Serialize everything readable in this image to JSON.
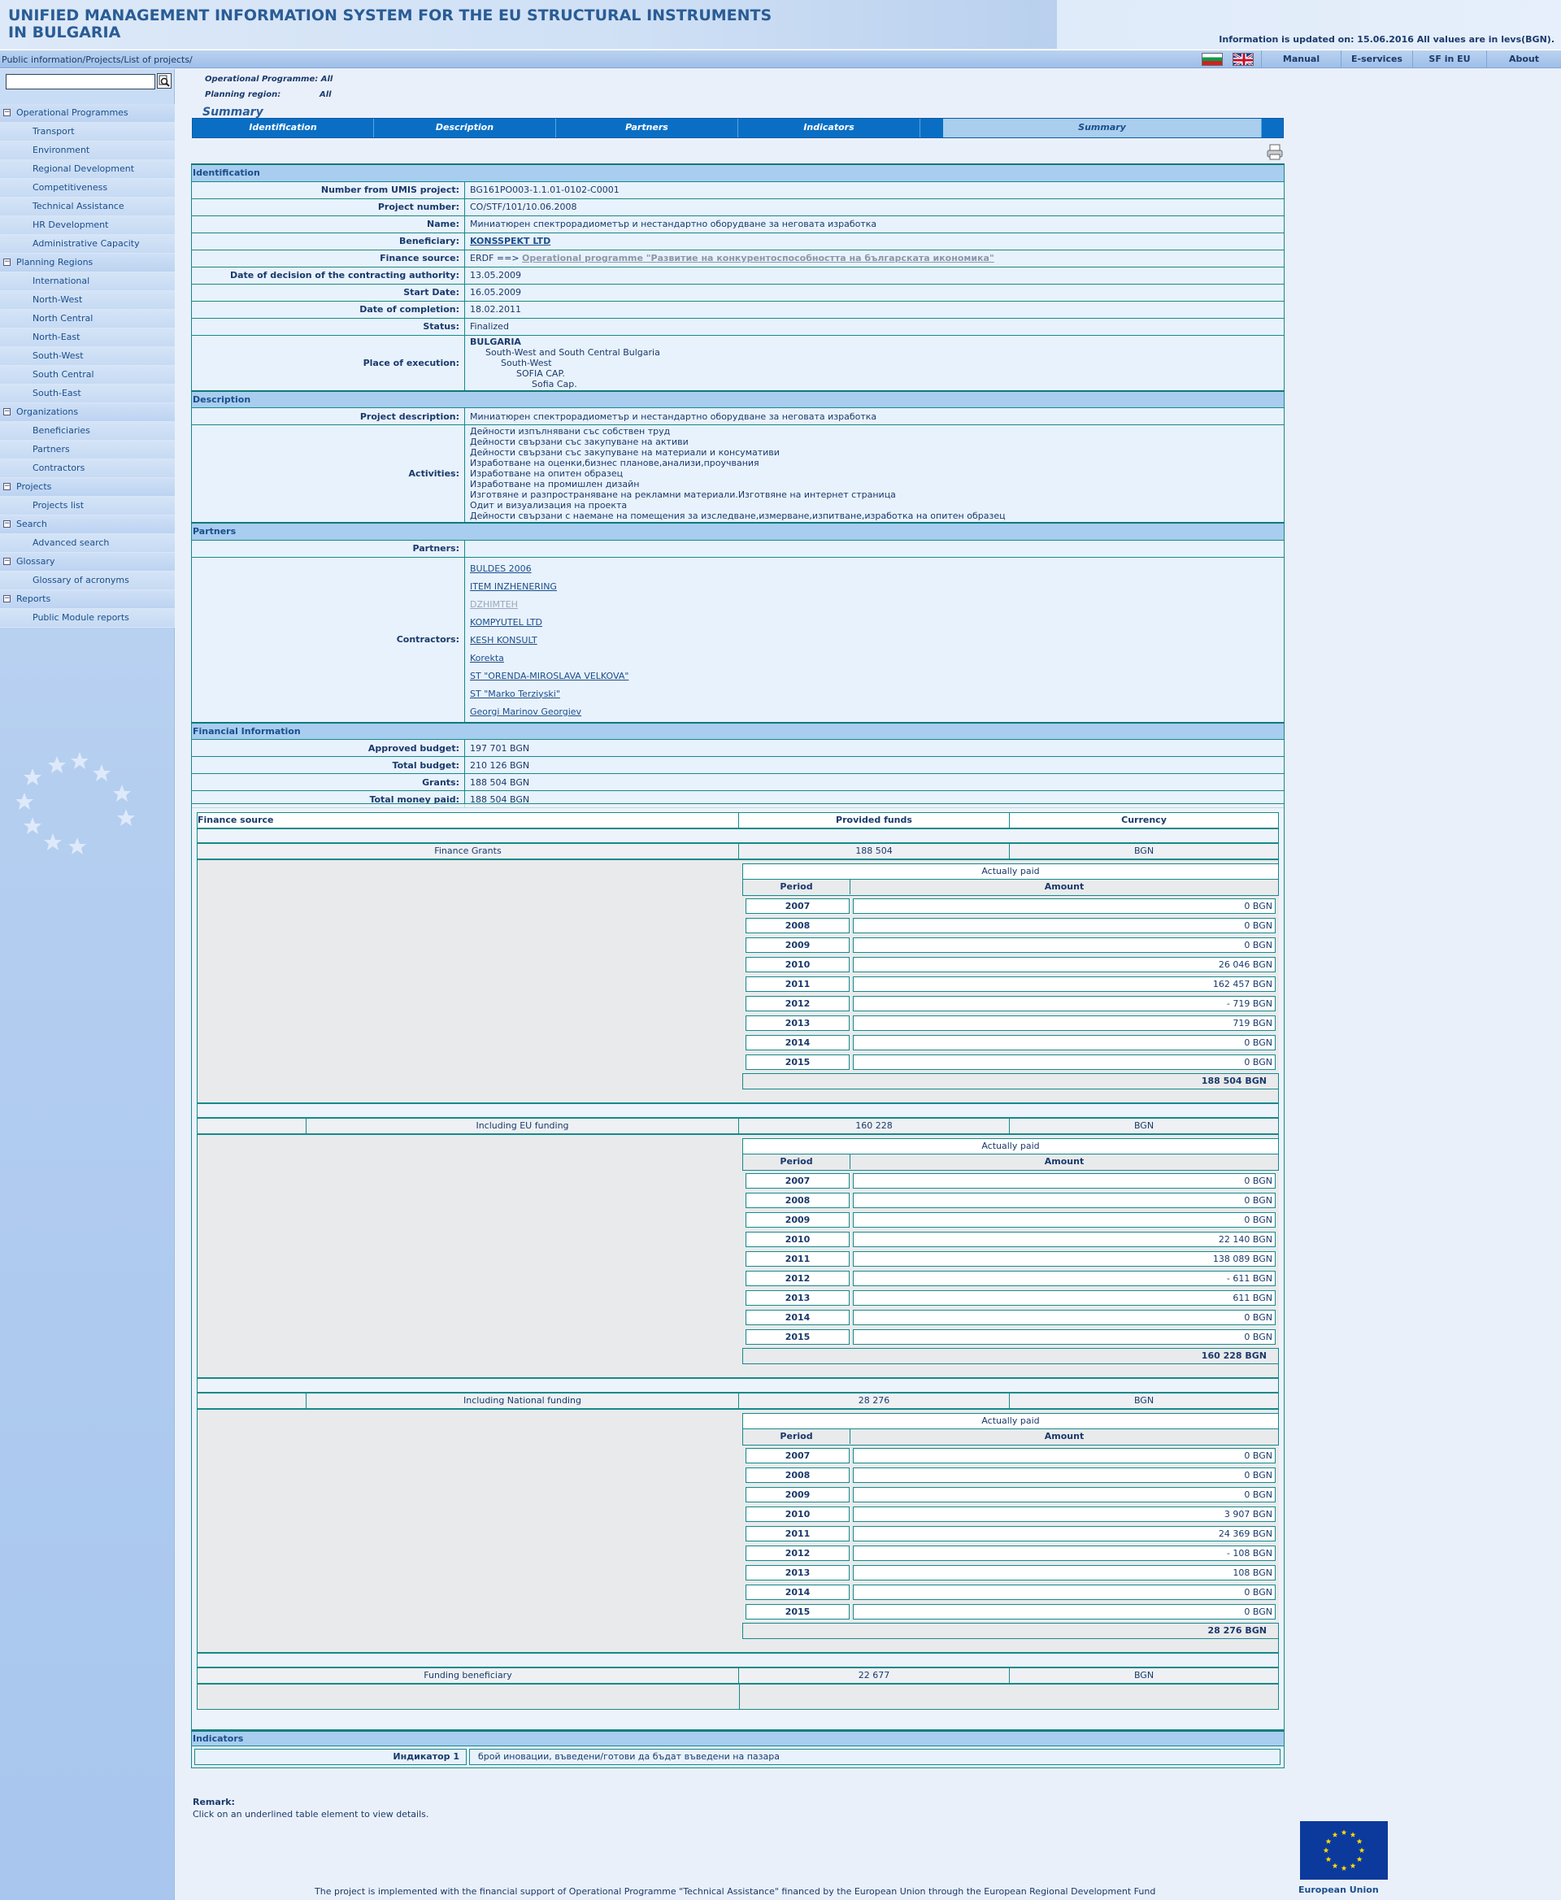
{
  "header": {
    "title_line1": "UNIFIED MANAGEMENT INFORMATION SYSTEM FOR THE EU STRUCTURAL INSTRUMENTS",
    "title_line2": "IN BULGARIA",
    "update_info": "Information is updated on: 15.06.2016 All values are in levs(BGN)."
  },
  "topbar": {
    "breadcrumb": "Public information/Projects/List of projects/",
    "nav": [
      "Manual",
      "E-services",
      "SF in EU",
      "About"
    ]
  },
  "sidebar": {
    "search_value": "",
    "groups": [
      {
        "label": "Operational Programmes",
        "items": [
          "Transport",
          "Environment",
          "Regional Development",
          "Competitiveness",
          "Technical Assistance",
          "HR Development",
          "Administrative Capacity"
        ]
      },
      {
        "label": "Planning Regions",
        "items": [
          "International",
          "North-West",
          "North Central",
          "North-East",
          "South-West",
          "South Central",
          "South-East"
        ]
      },
      {
        "label": "Organizations",
        "items": [
          "Beneficiaries",
          "Partners",
          "Contractors"
        ]
      },
      {
        "label": "Projects",
        "items": [
          "Projects list"
        ]
      },
      {
        "label": "Search",
        "items": [
          "Advanced search"
        ]
      },
      {
        "label": "Glossary",
        "items": [
          "Glossary of acronyms"
        ]
      },
      {
        "label": "Reports",
        "items": [
          "Public Module reports"
        ]
      }
    ]
  },
  "filters": {
    "operational_programme": "Operational Programme: All",
    "planning_region_label": "Planning region:",
    "planning_region_value": "All"
  },
  "page_title": "Summary",
  "tabs": [
    "Identification",
    "Description",
    "Partners",
    "Indicators",
    "Summary"
  ],
  "identification": {
    "heading": "Identification",
    "rows": [
      {
        "label": "Number from UMIS project:",
        "value": "BG161PO003-1.1.01-0102-C0001"
      },
      {
        "label": "Project number:",
        "value": "CO/STF/101/10.06.2008"
      },
      {
        "label": "Name:",
        "value": "Миниатюрен спектрорадиометър и нестандартно оборудване за неговата изработка"
      },
      {
        "label": "Beneficiary:",
        "value": "KONSSPEKT LTD"
      },
      {
        "label": "Finance source:",
        "value_prefix": "ERDF ==>",
        "value": "Operational programme \"Развитие на конкурентоспособността на българската икономика\""
      },
      {
        "label": "Date of decision of the contracting authority:",
        "value": "13.05.2009"
      },
      {
        "label": "Start Date:",
        "value": "16.05.2009"
      },
      {
        "label": "Date of completion:",
        "value": "18.02.2011"
      },
      {
        "label": "Status:",
        "value": "Finalized"
      }
    ],
    "place_label": "Place of execution:",
    "place": [
      "BULGARIA",
      "South-West and South Central Bulgaria",
      "South-West",
      "SOFIA CAP.",
      "Sofia Cap."
    ]
  },
  "description": {
    "heading": "Description",
    "project_description_label": "Project description:",
    "project_description": "Миниатюрен спектрорадиометър и нестандартно оборудване за неговата изработка",
    "activities_label": "Activities:",
    "activities": [
      "Дейности изпълнявани със собствен труд",
      "Дейности свързани със закупуване на активи",
      "Дейности свързани със закупуване на материали и консумативи",
      "Изработване на оценки,бизнес планове,анализи,проучвания",
      "Изработване на опитен образец",
      "Изработване на промишлен дизайн",
      "Изготвяне и разпространяване на рекламни материали.Изготвяне на интернет страница",
      "Одит и визуализация на проекта",
      "Дейности свързани с наемане на помещения за изследване,измерване,изпитване,изработка на опитен образец"
    ]
  },
  "partners": {
    "heading": "Partners",
    "partners_label": "Partners:",
    "contractors_label": "Contractors:",
    "contractors": [
      "BULDES 2006",
      "ITEM INZHENERING",
      "DZHIMTEH",
      "KOMPYUTEL LTD",
      "KESH KONSULT",
      "Korekta",
      "ST \"ORENDA-MIROSLAVA VELKOVA\"",
      "ST \"Marko Terziyski\"",
      "Georgi Marinov Georgiev"
    ]
  },
  "financial": {
    "heading": "Financial Information",
    "rows": [
      {
        "label": "Approved budget:",
        "value": "197 701 BGN"
      },
      {
        "label": "Total budget:",
        "value": "210 126 BGN"
      },
      {
        "label": "Grants:",
        "value": "188 504 BGN"
      },
      {
        "label": "Total money paid:",
        "value": "188 504 BGN"
      }
    ],
    "columns": [
      "Finance source",
      "Provided funds",
      "Currency"
    ],
    "actually_paid_label": "Actually paid",
    "period_label": "Period",
    "amount_label": "Amount",
    "blocks": [
      {
        "name": "Finance Grants",
        "funds": "188 504",
        "currency": "BGN",
        "paid": [
          [
            "2007",
            "0 BGN"
          ],
          [
            "2008",
            "0 BGN"
          ],
          [
            "2009",
            "0 BGN"
          ],
          [
            "2010",
            "26 046 BGN"
          ],
          [
            "2011",
            "162 457 BGN"
          ],
          [
            "2012",
            "- 719 BGN"
          ],
          [
            "2013",
            "719 BGN"
          ],
          [
            "2014",
            "0 BGN"
          ],
          [
            "2015",
            "0 BGN"
          ]
        ],
        "total": "188 504 BGN"
      },
      {
        "name": "Including EU funding",
        "funds": "160 228",
        "currency": "BGN",
        "paid": [
          [
            "2007",
            "0 BGN"
          ],
          [
            "2008",
            "0 BGN"
          ],
          [
            "2009",
            "0 BGN"
          ],
          [
            "2010",
            "22 140 BGN"
          ],
          [
            "2011",
            "138 089 BGN"
          ],
          [
            "2012",
            "- 611 BGN"
          ],
          [
            "2013",
            "611 BGN"
          ],
          [
            "2014",
            "0 BGN"
          ],
          [
            "2015",
            "0 BGN"
          ]
        ],
        "total": "160 228 BGN"
      },
      {
        "name": "Including National funding",
        "funds": "28 276",
        "currency": "BGN",
        "paid": [
          [
            "2007",
            "0 BGN"
          ],
          [
            "2008",
            "0 BGN"
          ],
          [
            "2009",
            "0 BGN"
          ],
          [
            "2010",
            "3 907 BGN"
          ],
          [
            "2011",
            "24 369 BGN"
          ],
          [
            "2012",
            "- 108 BGN"
          ],
          [
            "2013",
            "108 BGN"
          ],
          [
            "2014",
            "0 BGN"
          ],
          [
            "2015",
            "0 BGN"
          ]
        ],
        "total": "28 276 BGN"
      }
    ],
    "beneficiary_funding": {
      "name": "Funding beneficiary",
      "funds": "22 677",
      "currency": "BGN"
    }
  },
  "indicators": {
    "heading": "Indicators",
    "label": "Индикатор 1",
    "value": "брой иновации, въведени/готови да бъдат въведени на пазара"
  },
  "remark": {
    "title": "Remark:",
    "text": "Click on an underlined table element to view details."
  },
  "footer": {
    "text": "The project is implemented with the financial support of Operational Programme \"Technical Assistance\" financed by the European Union through the European Regional Development Fund",
    "eu_label": "European Union"
  }
}
